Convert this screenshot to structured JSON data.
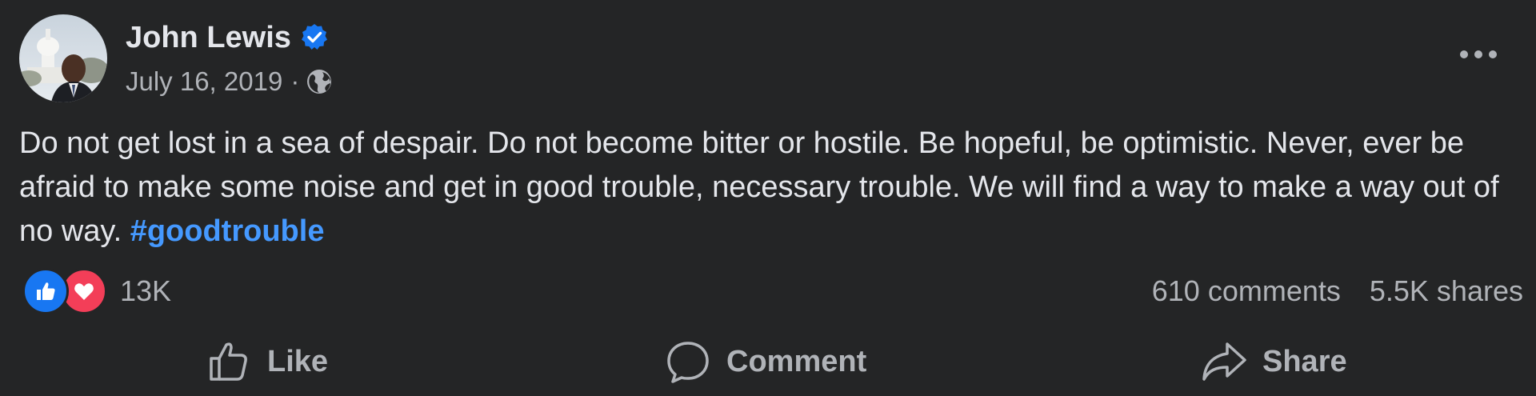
{
  "post": {
    "author": "John Lewis",
    "date": "July 16, 2019",
    "separator": "·",
    "privacy_icon": "globe-icon",
    "verified_icon": "verified-badge-icon",
    "more_icon": "more-options-icon",
    "text": "Do not get lost in a sea of despair. Do not become bitter or hostile. Be hopeful, be optimistic. Never, ever be afraid to make some noise and get in good trouble, necessary trouble. We will find a way to make a way out of no way.",
    "hashtag": "#goodtrouble"
  },
  "stats": {
    "reaction_count": "13K",
    "reactions": [
      "like",
      "love"
    ],
    "comments": "610 comments",
    "shares": "5.5K shares"
  },
  "actions": {
    "like": "Like",
    "comment": "Comment",
    "share": "Share"
  },
  "colors": {
    "background": "#242526",
    "primary_text": "#e4e6eb",
    "secondary_text": "#b0b3b8",
    "link": "#4599ff",
    "like_blue": "#1877f2",
    "love_red": "#f33e58"
  }
}
